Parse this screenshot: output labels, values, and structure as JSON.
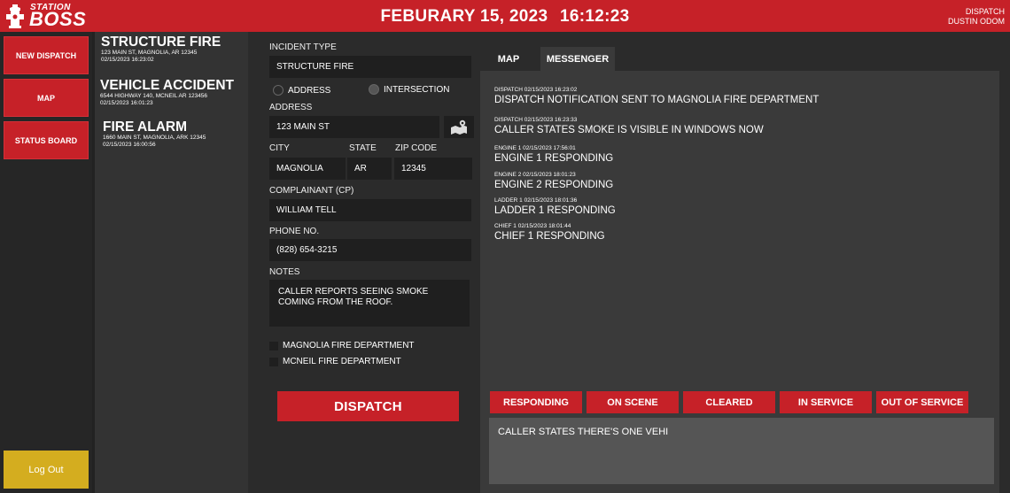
{
  "header": {
    "logo_line1": "STATION",
    "logo_line2": "BOSS",
    "date": "FEBURARY 15, 2023",
    "time": "16:12:23",
    "user_role": "DISPATCH",
    "user_name": "DUSTIN ODOM"
  },
  "nav": {
    "new_dispatch": "NEW DISPATCH",
    "map": "MAP",
    "status_board": "STATUS BOARD",
    "logout": "Log Out"
  },
  "incidents": [
    {
      "title": "STRUCTURE FIRE",
      "address": "123 MAIN ST, MAGNOLIA, AR 12345",
      "time": "02/15/2023 16:23:02"
    },
    {
      "title": "VEHICLE ACCIDENT",
      "address": "6544 HIGHWAY 140, MCNEIL AR 123456",
      "time": "02/15/2023 16:01:23"
    },
    {
      "title": "FIRE ALARM",
      "address": "1660 MAIN ST, MAGNOLIA, ARK 12345",
      "time": "02/15/2023 16:00:56"
    }
  ],
  "form": {
    "incident_type_label": "INCIDENT TYPE",
    "incident_type_value": "STRUCTURE FIRE",
    "radio_address": "ADDRESS",
    "radio_intersection": "INTERSECTION",
    "address_label": "ADDRESS",
    "address_value": "123 MAIN ST",
    "city_label": "CITY",
    "city_value": "MAGNOLIA",
    "state_label": "STATE",
    "state_value": "AR",
    "zip_label": "ZIP CODE",
    "zip_value": "12345",
    "complainant_label": "COMPLAINANT (CP)",
    "complainant_value": "WILLIAM TELL",
    "phone_label": "PHONE NO.",
    "phone_value": "(828) 654-3215",
    "notes_label": "NOTES",
    "notes_value": "CALLER REPORTS SEEING SMOKE COMING FROM THE ROOF.",
    "dept1": "MAGNOLIA FIRE DEPARTMENT",
    "dept2": "MCNEIL FIRE DEPARTMENT",
    "dispatch_button": "DISPATCH"
  },
  "tabs": {
    "map": "MAP",
    "messenger": "MESSENGER"
  },
  "messages": [
    {
      "meta": "DISPATCH 02/15/2023 16:23:02",
      "text": "DISPATCH NOTIFICATION SENT TO MAGNOLIA FIRE DEPARTMENT"
    },
    {
      "meta": "DISPATCH 02/15/2023 16:23:33",
      "text": "CALLER STATES SMOKE IS VISIBLE IN WINDOWS NOW"
    },
    {
      "meta": "ENGINE 1 02/15/2023 17:56:01",
      "text": "ENGINE 1 RESPONDING"
    },
    {
      "meta": "ENGINE 2 02/15/2023 18:01:23",
      "text": "ENGINE 2 RESPONDING"
    },
    {
      "meta": "LADDER 1 02/15/2023 18:01:36",
      "text": "LADDER 1 RESPONDING"
    },
    {
      "meta": "CHIEF 1 02/15/2023 18:01:44",
      "text": "CHIEF 1 RESPONDING"
    }
  ],
  "status_buttons": {
    "responding": "RESPONDING",
    "on_scene": "ON SCENE",
    "cleared": "CLEARED",
    "in_service": "IN SERVICE",
    "out_of_service": "OUT OF SERVICE"
  },
  "message_input": "CALLER STATES THERE'S ONE VEHI",
  "colors": {
    "brand_red": "#c62128",
    "logout_gold": "#d4ad1f"
  }
}
